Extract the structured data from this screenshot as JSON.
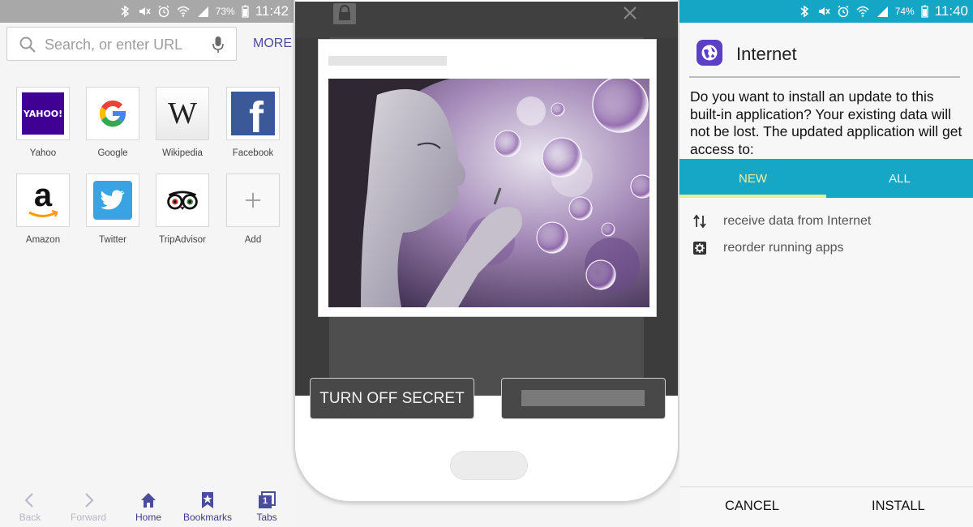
{
  "left_panel": {
    "status": {
      "battery": "73%",
      "time": "11:42"
    },
    "search": {
      "placeholder": "Search, or enter URL"
    },
    "more_label": "MORE",
    "tiles": [
      {
        "label": "Yahoo",
        "logo_text": "YAHOO!",
        "icon": "yahoo-logo"
      },
      {
        "label": "Google",
        "logo_text": "G",
        "icon": "google-logo"
      },
      {
        "label": "Wikipedia",
        "logo_text": "W",
        "icon": "wikipedia-logo"
      },
      {
        "label": "Facebook",
        "logo_text": "f",
        "icon": "facebook-logo"
      },
      {
        "label": "Amazon",
        "logo_text": "a",
        "icon": "amazon-logo"
      },
      {
        "label": "Twitter",
        "icon": "twitter-logo"
      },
      {
        "label": "TripAdvisor",
        "icon": "tripadvisor-logo"
      },
      {
        "label": "Add",
        "icon": "plus-icon"
      }
    ],
    "bottom_nav": [
      {
        "label": "Back",
        "icon": "chevron-left-icon",
        "enabled": false
      },
      {
        "label": "Forward",
        "icon": "chevron-right-icon",
        "enabled": false
      },
      {
        "label": "Home",
        "icon": "home-icon",
        "enabled": true
      },
      {
        "label": "Bookmarks",
        "icon": "bookmark-star-icon",
        "enabled": true
      },
      {
        "label": "Tabs",
        "icon": "tabs-icon",
        "badge": "1",
        "enabled": true
      }
    ]
  },
  "middle_panel": {
    "secret_mode_button": "TURN OFF SECRET",
    "icons": [
      "lock-icon",
      "close-icon"
    ]
  },
  "right_panel": {
    "status": {
      "battery": "74%",
      "time": "11:40"
    },
    "app_name": "Internet",
    "question": "Do you want to install an update to this built-in application? Your existing data will not be lost. The updated application will get access to:",
    "tabs": [
      {
        "label": "NEW",
        "selected": true
      },
      {
        "label": "ALL",
        "selected": false
      }
    ],
    "permissions": [
      {
        "label": "receive data from Internet",
        "icon": "data-transfer-icon"
      },
      {
        "label": "reorder running apps",
        "icon": "gear-icon"
      }
    ],
    "cancel_label": "CANCEL",
    "install_label": "INSTALL"
  },
  "colors": {
    "accent_purple": "#4b4c9a",
    "status_teal": "#14a6c4",
    "tab_indicator": "#e8ef8c",
    "dark_overlay": "#4e4e4e"
  }
}
